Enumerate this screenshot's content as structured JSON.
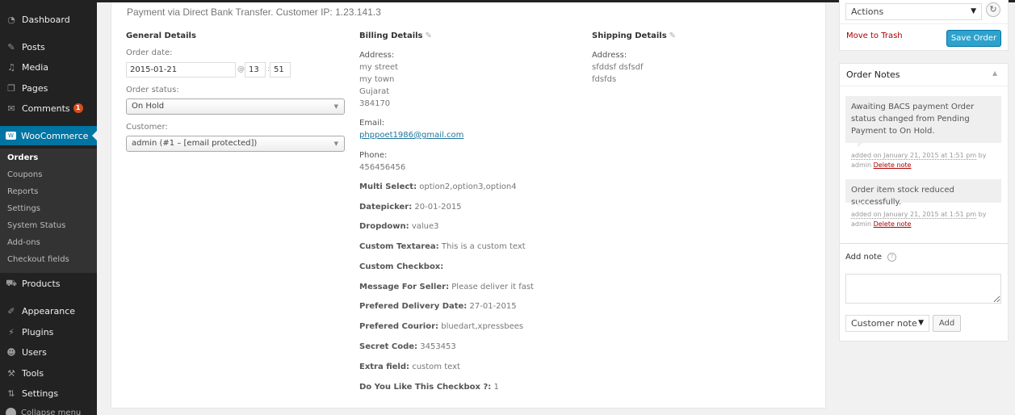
{
  "sidebar": {
    "items": [
      {
        "label": "Dashboard",
        "icon": "dashboard-icon",
        "glyph": "◔"
      },
      {
        "label": "Posts",
        "icon": "pin-icon",
        "glyph": "✎"
      },
      {
        "label": "Media",
        "icon": "media-icon",
        "glyph": "♫"
      },
      {
        "label": "Pages",
        "icon": "pages-icon",
        "glyph": "❐"
      },
      {
        "label": "Comments",
        "icon": "comment-icon",
        "glyph": "✉",
        "badge": "1"
      },
      {
        "label": "WooCommerce",
        "icon": "woocommerce-icon",
        "glyph": "W"
      },
      {
        "label": "Products",
        "icon": "cart-icon",
        "glyph": "⛟"
      },
      {
        "label": "Appearance",
        "icon": "paintbrush-icon",
        "glyph": "✐"
      },
      {
        "label": "Plugins",
        "icon": "plugin-icon",
        "glyph": "⚡"
      },
      {
        "label": "Users",
        "icon": "user-icon",
        "glyph": "☻"
      },
      {
        "label": "Tools",
        "icon": "wrench-icon",
        "glyph": "⚒"
      },
      {
        "label": "Settings",
        "icon": "settings-icon",
        "glyph": "⇅"
      }
    ],
    "submenu": [
      "Orders",
      "Coupons",
      "Reports",
      "Settings",
      "System Status",
      "Add-ons",
      "Checkout fields"
    ],
    "collapse_label": "Collapse menu"
  },
  "order": {
    "payment_line": "Payment via Direct Bank Transfer. Customer IP: 1.23.141.3",
    "general": {
      "heading": "General Details",
      "date_label": "Order date:",
      "date": "2015-01-21",
      "at": "@",
      "hour": "13",
      "colon": ":",
      "minute": "51",
      "status_label": "Order status:",
      "status": "On Hold",
      "customer_label": "Customer:",
      "customer": "admin (#1 – [email protected])"
    },
    "billing": {
      "heading": "Billing Details",
      "address_label": "Address:",
      "address": [
        "my street",
        "my town",
        "Gujarat",
        "384170"
      ],
      "email_label": "Email:",
      "email": "phppoet1986@gmail.com",
      "phone_label": "Phone:",
      "phone": "456456456",
      "fields": [
        {
          "label": "Multi Select:",
          "value": "option2,option3,option4"
        },
        {
          "label": "Datepicker:",
          "value": "20-01-2015"
        },
        {
          "label": "Dropdown:",
          "value": "value3"
        },
        {
          "label": "Custom Textarea:",
          "value": "This is a custom text"
        },
        {
          "label": "Custom Checkbox:",
          "value": ""
        },
        {
          "label": "Message For Seller:",
          "value": "Please deliver it fast"
        },
        {
          "label": "Prefered Delivery Date:",
          "value": "27-01-2015"
        },
        {
          "label": "Prefered Courior:",
          "value": "bluedart,xpressbees"
        },
        {
          "label": "Secret Code:",
          "value": "3453453"
        },
        {
          "label": "Extra field:",
          "value": "custom text"
        },
        {
          "label": "Do You Like This Checkbox ?:",
          "value": "1"
        }
      ]
    },
    "shipping": {
      "heading": "Shipping Details",
      "address_label": "Address:",
      "address": [
        "sfddsf dsfsdf",
        "fdsfds"
      ]
    }
  },
  "actions": {
    "select": "Actions",
    "trash": "Move to Trash",
    "save": "Save Order",
    "accent": "#2ea2cc"
  },
  "notes": {
    "title": "Order Notes",
    "items": [
      {
        "text": "Awaiting BACS payment Order status changed from Pending Payment to On Hold.",
        "date": "added on January 21, 2015 at 1:51 pm",
        "by": " by admin ",
        "delete": "Delete note"
      },
      {
        "text": "Order item stock reduced successfully.",
        "date": "added on January 21, 2015 at 1:51 pm",
        "by": " by admin ",
        "delete": "Delete note"
      }
    ],
    "add_label": "Add note",
    "textarea_value": "",
    "type_select": "Customer note",
    "add_button": "Add"
  }
}
